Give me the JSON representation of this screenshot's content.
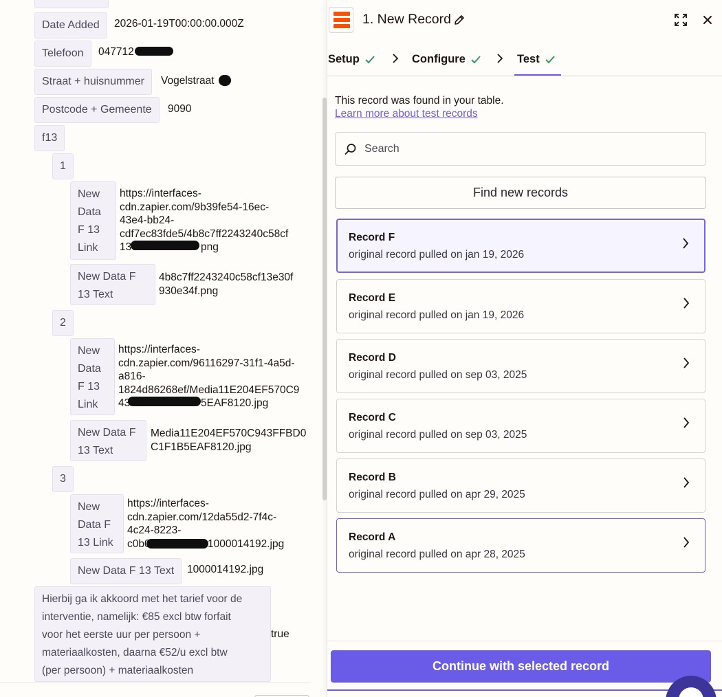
{
  "left": {
    "date_added": {
      "label": "Date Added",
      "value": "2026-01-19T00:00:00.000Z"
    },
    "telefoon": {
      "label": "Telefoon",
      "value": "047712"
    },
    "straat": {
      "label": "Straat + huisnummer",
      "value": "Vogelstraat"
    },
    "postcode": {
      "label": "Postcode + Gemeente",
      "value": "9090"
    },
    "f13": {
      "label": "f13"
    },
    "items": [
      {
        "index": "1",
        "link_label": "New\nData\nF 13\nLink",
        "link_value": "https://interfaces-\ncdn.zapier.com/9b39fe54-16ec-\n43e4-bb24-\ncdf7ec83fde5/4b8c7ff2243240c58cf\n13e",
        "link_tail": "png",
        "text_label": "New Data F\n13 Text",
        "text_value": "4b8c7ff2243240c58cf13e30f\n930e34f.png"
      },
      {
        "index": "2",
        "link_label": "New\nData\nF 13\nLink",
        "link_value": "https://interfaces-\ncdn.zapier.com/96116297-31f1-4a5d-\na816-\n1824d86268ef/Media11E204EF570C9\n43",
        "link_tail": "5EAF8120.jpg",
        "text_label": "New Data F\n13 Text",
        "text_value": "Media11E204EF570C943FFBD0\nC1F1B5EAF8120.jpg"
      },
      {
        "index": "3",
        "link_label": "New\nData F\n13 Link",
        "link_value": "https://interfaces-\ncdn.zapier.com/12da55d2-7f4c-\n4c24-8223-\nc0b0",
        "link_tail": "1000014192.jpg",
        "text_label": "New Data F 13 Text",
        "text_value": "1000014192.jpg"
      }
    ],
    "agreement": {
      "label": "Hierbij ga ik akkoord met het tarief voor de\ninterventie, namelijk: €85 excl btw forfait\nvoor het eerste uur per persoon +\nmateriaalkosten, daarna €52/u excl btw\n(per persoon) + materiaalkosten",
      "value": "true"
    }
  },
  "panel": {
    "title": "1. New Record",
    "steps": [
      {
        "label": "Setup",
        "done": true
      },
      {
        "label": "Configure",
        "done": true
      },
      {
        "label": "Test",
        "done": true,
        "active": true
      }
    ],
    "found_text": "This record was found in your table.",
    "learn_link": "Learn more about test records",
    "search_placeholder": "Search",
    "find_button": "Find new records",
    "records": [
      {
        "name": "Record F",
        "subtitle": "original record pulled on jan 19, 2026"
      },
      {
        "name": "Record E",
        "subtitle": "original record pulled on jan 19, 2026"
      },
      {
        "name": "Record D",
        "subtitle": "original record pulled on sep 03, 2025"
      },
      {
        "name": "Record C",
        "subtitle": "original record pulled on sep 03, 2025"
      },
      {
        "name": "Record B",
        "subtitle": "original record pulled on apr 29, 2025"
      },
      {
        "name": "Record A",
        "subtitle": "original record pulled on apr 28, 2025"
      }
    ],
    "continue_button": "Continue with selected record",
    "colors": {
      "accent": "#6b5ce7",
      "brand": "#ff4f00",
      "check": "#2f9e5a"
    }
  }
}
